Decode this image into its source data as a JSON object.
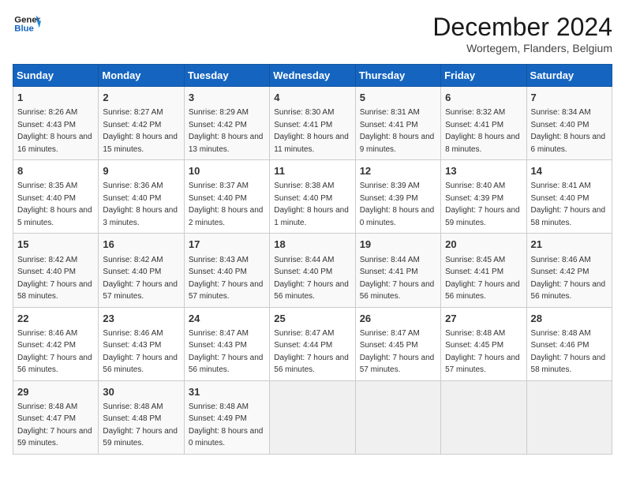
{
  "header": {
    "logo_line1": "General",
    "logo_line2": "Blue",
    "month": "December 2024",
    "location": "Wortegem, Flanders, Belgium"
  },
  "columns": [
    "Sunday",
    "Monday",
    "Tuesday",
    "Wednesday",
    "Thursday",
    "Friday",
    "Saturday"
  ],
  "weeks": [
    [
      {
        "day": "1",
        "sunrise": "Sunrise: 8:26 AM",
        "sunset": "Sunset: 4:43 PM",
        "daylight": "Daylight: 8 hours and 16 minutes."
      },
      {
        "day": "2",
        "sunrise": "Sunrise: 8:27 AM",
        "sunset": "Sunset: 4:42 PM",
        "daylight": "Daylight: 8 hours and 15 minutes."
      },
      {
        "day": "3",
        "sunrise": "Sunrise: 8:29 AM",
        "sunset": "Sunset: 4:42 PM",
        "daylight": "Daylight: 8 hours and 13 minutes."
      },
      {
        "day": "4",
        "sunrise": "Sunrise: 8:30 AM",
        "sunset": "Sunset: 4:41 PM",
        "daylight": "Daylight: 8 hours and 11 minutes."
      },
      {
        "day": "5",
        "sunrise": "Sunrise: 8:31 AM",
        "sunset": "Sunset: 4:41 PM",
        "daylight": "Daylight: 8 hours and 9 minutes."
      },
      {
        "day": "6",
        "sunrise": "Sunrise: 8:32 AM",
        "sunset": "Sunset: 4:41 PM",
        "daylight": "Daylight: 8 hours and 8 minutes."
      },
      {
        "day": "7",
        "sunrise": "Sunrise: 8:34 AM",
        "sunset": "Sunset: 4:40 PM",
        "daylight": "Daylight: 8 hours and 6 minutes."
      }
    ],
    [
      {
        "day": "8",
        "sunrise": "Sunrise: 8:35 AM",
        "sunset": "Sunset: 4:40 PM",
        "daylight": "Daylight: 8 hours and 5 minutes."
      },
      {
        "day": "9",
        "sunrise": "Sunrise: 8:36 AM",
        "sunset": "Sunset: 4:40 PM",
        "daylight": "Daylight: 8 hours and 3 minutes."
      },
      {
        "day": "10",
        "sunrise": "Sunrise: 8:37 AM",
        "sunset": "Sunset: 4:40 PM",
        "daylight": "Daylight: 8 hours and 2 minutes."
      },
      {
        "day": "11",
        "sunrise": "Sunrise: 8:38 AM",
        "sunset": "Sunset: 4:40 PM",
        "daylight": "Daylight: 8 hours and 1 minute."
      },
      {
        "day": "12",
        "sunrise": "Sunrise: 8:39 AM",
        "sunset": "Sunset: 4:39 PM",
        "daylight": "Daylight: 8 hours and 0 minutes."
      },
      {
        "day": "13",
        "sunrise": "Sunrise: 8:40 AM",
        "sunset": "Sunset: 4:39 PM",
        "daylight": "Daylight: 7 hours and 59 minutes."
      },
      {
        "day": "14",
        "sunrise": "Sunrise: 8:41 AM",
        "sunset": "Sunset: 4:40 PM",
        "daylight": "Daylight: 7 hours and 58 minutes."
      }
    ],
    [
      {
        "day": "15",
        "sunrise": "Sunrise: 8:42 AM",
        "sunset": "Sunset: 4:40 PM",
        "daylight": "Daylight: 7 hours and 58 minutes."
      },
      {
        "day": "16",
        "sunrise": "Sunrise: 8:42 AM",
        "sunset": "Sunset: 4:40 PM",
        "daylight": "Daylight: 7 hours and 57 minutes."
      },
      {
        "day": "17",
        "sunrise": "Sunrise: 8:43 AM",
        "sunset": "Sunset: 4:40 PM",
        "daylight": "Daylight: 7 hours and 57 minutes."
      },
      {
        "day": "18",
        "sunrise": "Sunrise: 8:44 AM",
        "sunset": "Sunset: 4:40 PM",
        "daylight": "Daylight: 7 hours and 56 minutes."
      },
      {
        "day": "19",
        "sunrise": "Sunrise: 8:44 AM",
        "sunset": "Sunset: 4:41 PM",
        "daylight": "Daylight: 7 hours and 56 minutes."
      },
      {
        "day": "20",
        "sunrise": "Sunrise: 8:45 AM",
        "sunset": "Sunset: 4:41 PM",
        "daylight": "Daylight: 7 hours and 56 minutes."
      },
      {
        "day": "21",
        "sunrise": "Sunrise: 8:46 AM",
        "sunset": "Sunset: 4:42 PM",
        "daylight": "Daylight: 7 hours and 56 minutes."
      }
    ],
    [
      {
        "day": "22",
        "sunrise": "Sunrise: 8:46 AM",
        "sunset": "Sunset: 4:42 PM",
        "daylight": "Daylight: 7 hours and 56 minutes."
      },
      {
        "day": "23",
        "sunrise": "Sunrise: 8:46 AM",
        "sunset": "Sunset: 4:43 PM",
        "daylight": "Daylight: 7 hours and 56 minutes."
      },
      {
        "day": "24",
        "sunrise": "Sunrise: 8:47 AM",
        "sunset": "Sunset: 4:43 PM",
        "daylight": "Daylight: 7 hours and 56 minutes."
      },
      {
        "day": "25",
        "sunrise": "Sunrise: 8:47 AM",
        "sunset": "Sunset: 4:44 PM",
        "daylight": "Daylight: 7 hours and 56 minutes."
      },
      {
        "day": "26",
        "sunrise": "Sunrise: 8:47 AM",
        "sunset": "Sunset: 4:45 PM",
        "daylight": "Daylight: 7 hours and 57 minutes."
      },
      {
        "day": "27",
        "sunrise": "Sunrise: 8:48 AM",
        "sunset": "Sunset: 4:45 PM",
        "daylight": "Daylight: 7 hours and 57 minutes."
      },
      {
        "day": "28",
        "sunrise": "Sunrise: 8:48 AM",
        "sunset": "Sunset: 4:46 PM",
        "daylight": "Daylight: 7 hours and 58 minutes."
      }
    ],
    [
      {
        "day": "29",
        "sunrise": "Sunrise: 8:48 AM",
        "sunset": "Sunset: 4:47 PM",
        "daylight": "Daylight: 7 hours and 59 minutes."
      },
      {
        "day": "30",
        "sunrise": "Sunrise: 8:48 AM",
        "sunset": "Sunset: 4:48 PM",
        "daylight": "Daylight: 7 hours and 59 minutes."
      },
      {
        "day": "31",
        "sunrise": "Sunrise: 8:48 AM",
        "sunset": "Sunset: 4:49 PM",
        "daylight": "Daylight: 8 hours and 0 minutes."
      },
      null,
      null,
      null,
      null
    ]
  ]
}
